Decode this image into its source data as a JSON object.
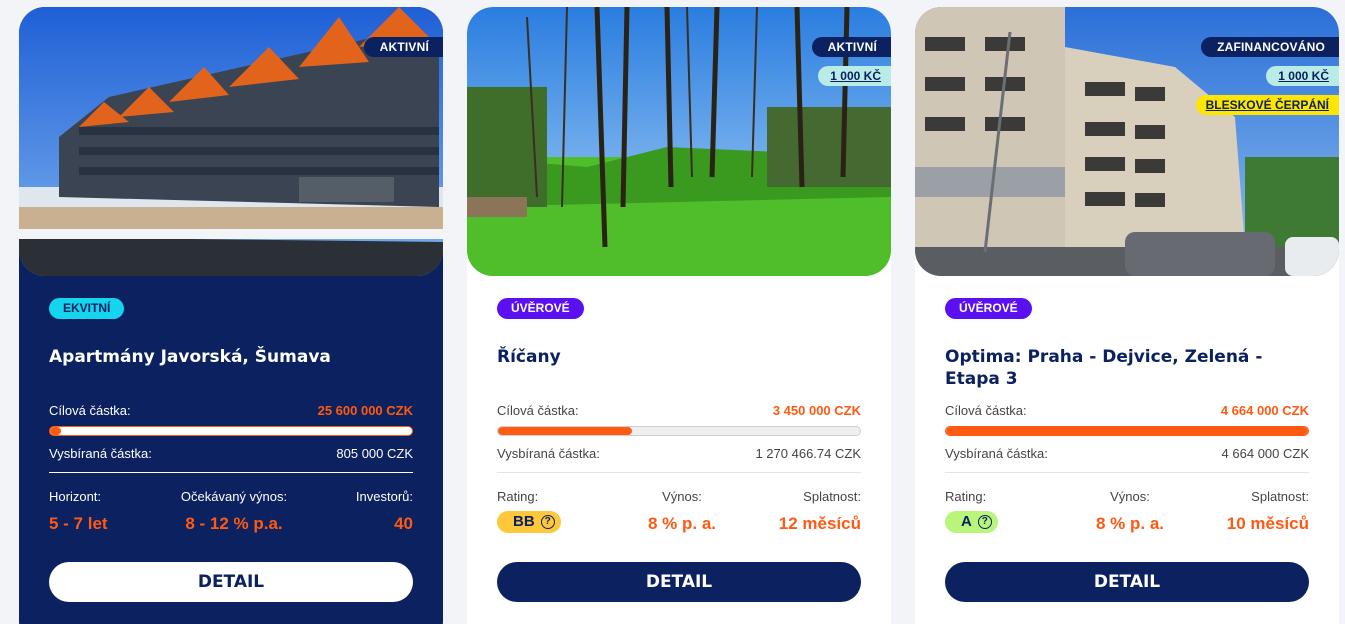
{
  "cards": [
    {
      "status": "AKTIVNÍ",
      "type": "EKVITNÍ",
      "title": "Apartmány Javorská, Šumava",
      "target_label": "Cílová částka:",
      "target_value": "25 600 000 CZK",
      "raised_label": "Vysbíraná částka:",
      "raised_value": "805 000 CZK",
      "progress": 0.03,
      "stats": [
        {
          "label": "Horizont:",
          "value": "5 - 7 let"
        },
        {
          "label": "Očekávaný výnos:",
          "value": "8 - 12 % p.a."
        },
        {
          "label": "Investorů:",
          "value": "40"
        }
      ],
      "button": "DETAIL"
    },
    {
      "status": "AKTIVNÍ",
      "min_invest": "1 000 KČ",
      "type": "ÚVĚROVÉ",
      "title": "Říčany",
      "target_label": "Cílová částka:",
      "target_value": "3 450 000 CZK",
      "raised_label": "Vysbíraná částka:",
      "raised_value": "1 270 466.74 CZK",
      "progress": 0.37,
      "stats": [
        {
          "label": "Rating:",
          "value": "BB"
        },
        {
          "label": "Výnos:",
          "value": "8 % p. a."
        },
        {
          "label": "Splatnost:",
          "value": "12 měsíců"
        }
      ],
      "button": "DETAIL"
    },
    {
      "status": "ZAFINANCOVÁNO",
      "min_invest": "1 000 KČ",
      "flash": "BLESKOVÉ ČERPÁNÍ",
      "type": "ÚVĚROVÉ",
      "title": "Optima: Praha - Dejvice, Zelená - Etapa 3",
      "target_label": "Cílová částka:",
      "target_value": "4 664 000 CZK",
      "raised_label": "Vysbíraná částka:",
      "raised_value": "4 664 000 CZK",
      "progress": 1.0,
      "stats": [
        {
          "label": "Rating:",
          "value": "A"
        },
        {
          "label": "Výnos:",
          "value": "8 % p. a."
        },
        {
          "label": "Splatnost:",
          "value": "10 měsíců"
        }
      ],
      "button": "DETAIL"
    }
  ],
  "colors": {
    "navy": "#0b2160",
    "orange": "#ff5a12",
    "cyan": "#14d4ee",
    "violet": "#5a10f0",
    "yellow": "#ffe600"
  },
  "icons": {
    "rating_help": "question-circle-icon"
  }
}
